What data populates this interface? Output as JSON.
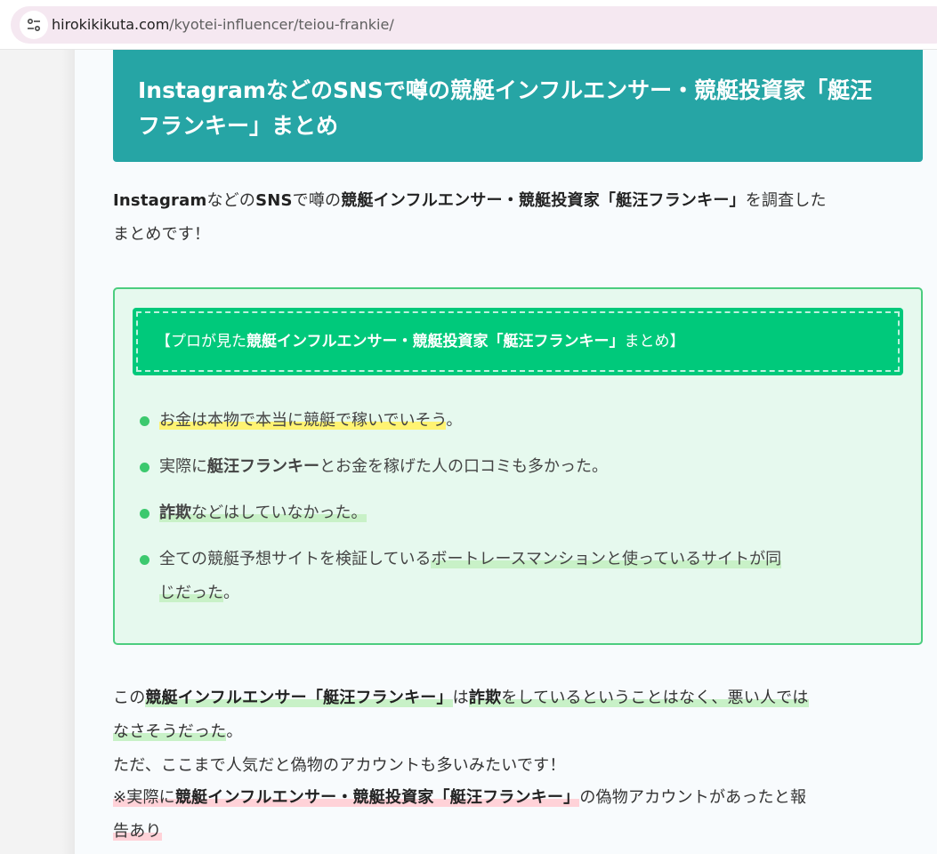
{
  "browser": {
    "url_host": "hirokikikuta.com",
    "url_path": "/kyotei-influencer/teiou-frankie/"
  },
  "article": {
    "heading_line1": "InstagramなどのSNSで噂の競艇インフルエンサー・競艇投資家「艇汪",
    "heading_line2": "フランキー」まとめ",
    "intro": {
      "t1": "Instagram",
      "t2": "などの",
      "t3": "SNS",
      "t4": "で噂の",
      "t5": "競艇インフルエンサー・競艇投資家「艇汪フランキー」",
      "t6": "を調査した",
      "t7": "まとめです！"
    },
    "summary_box": {
      "title_prefix": "【プロが見た",
      "title_bold": "競艇インフルエンサー・競艇投資家「艇汪フランキー」",
      "title_suffix": "まとめ】",
      "items": [
        {
          "a": "お金は本物で本当に競艇で稼いでいそう",
          "b": "。"
        },
        {
          "a": "実際に",
          "b": "艇汪フランキー",
          "c": "とお金を稼げた人の口コミも多かった。"
        },
        {
          "a": "詐欺",
          "b": "などはしていなかった。"
        },
        {
          "a": "全ての競艇予想サイトを検証している",
          "b": "ボートレースマンションと使っているサイトが同",
          "c": "じだった",
          "d": "。"
        }
      ]
    },
    "closing": {
      "p1": "この",
      "p2": "競艇インフルエンサー「艇汪フランキー」",
      "p3": "は",
      "p4": "詐欺",
      "p5": "をしているということはなく、悪い人では",
      "p6": "なさそうだった",
      "p7": "。",
      "line2": "ただ、ここまで人気だと偽物のアカウントも多いみたいです！",
      "n1": "※実際に",
      "n2": "競艇インフルエンサー・競艇投資家「艇汪フランキー」",
      "n3": "の偽物アカウントがあったと報",
      "n4": "告あり"
    }
  },
  "colors": {
    "heading_bg": "#26a5a5",
    "box_bg": "#e6f9ee",
    "box_border": "#4ccd7f",
    "box_title_bg": "#00c97b",
    "highlight_yellow": "#fff372",
    "highlight_green": "#c8f1c7",
    "highlight_pink": "#ffd2d8"
  },
  "icons": [
    "site-info-tune-icon",
    "bullet-dot-icon"
  ]
}
